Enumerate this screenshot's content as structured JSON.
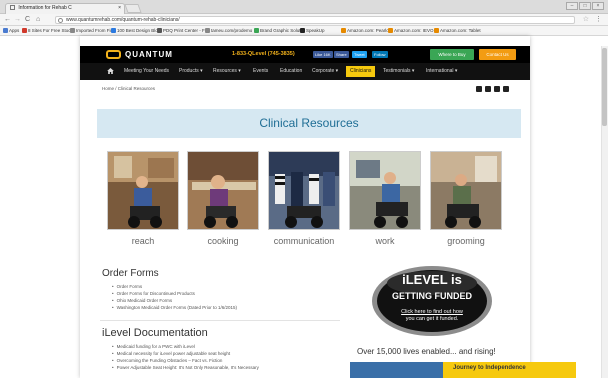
{
  "browser": {
    "tab_title": "Information for Rehab C",
    "tab_close": "×",
    "url": "www.quantumrehab.com/quantum-rehab-clinicians/",
    "win_controls": [
      "–",
      "□",
      "×"
    ],
    "nav": {
      "back": "←",
      "forward": "→",
      "reload": "C",
      "home": "⌂"
    },
    "star": "☆",
    "menu": "⋮"
  },
  "bookmarks": [
    {
      "label": "Apps",
      "color": "#4a7bd0"
    },
    {
      "label": "8 Sites For Free Stoc",
      "color": "#d0392b"
    },
    {
      "label": "Imported From Firef",
      "color": "#888888"
    },
    {
      "label": "100 Best Design Blo",
      "color": "#2d7be0"
    },
    {
      "label": "PDQ Print Center - F",
      "color": "#555555"
    },
    {
      "label": "tameu.com/prodemo",
      "color": "#888888"
    },
    {
      "label": "Brand Graphic Soluti",
      "color": "#3aa655"
    },
    {
      "label": "SpeakUp",
      "color": "#222222"
    },
    {
      "label": "Amazon.com: Pearlc",
      "color": "#e68a00"
    },
    {
      "label": "Amazon.com: IEVO",
      "color": "#e68a00"
    },
    {
      "label": "Amazon.com: Tablet",
      "color": "#e68a00"
    }
  ],
  "header": {
    "logo": "QUANTUM",
    "phone": "1-833-QLevel (745-3835)",
    "social": [
      {
        "label": "Like 16K",
        "color": "#3b5998"
      },
      {
        "label": "Share",
        "color": "#3b5998"
      },
      {
        "label": "Tweet",
        "color": "#1da1f2"
      },
      {
        "label": "Follow",
        "color": "#0077b5"
      }
    ],
    "cta": [
      {
        "label": "Where to Buy",
        "color": "#3aa655"
      },
      {
        "label": "Contact Us",
        "color": "#f39c12"
      }
    ]
  },
  "nav": {
    "items": [
      {
        "label": "Meeting Your Needs",
        "active": false
      },
      {
        "label": "Products ▾",
        "active": false
      },
      {
        "label": "Resources ▾",
        "active": false
      },
      {
        "label": "Events",
        "active": false
      },
      {
        "label": "Education",
        "active": false
      },
      {
        "label": "Corporate ▾",
        "active": false
      },
      {
        "label": "Clinicians",
        "active": true
      },
      {
        "label": "Testimonials ▾",
        "active": false
      },
      {
        "label": "International ▾",
        "active": false
      }
    ]
  },
  "breadcrumb": "Home / Clinical Resources",
  "banner_title": "Clinical Resources",
  "activities": [
    {
      "label": "reach"
    },
    {
      "label": "cooking"
    },
    {
      "label": "communication"
    },
    {
      "label": "work"
    },
    {
      "label": "grooming"
    }
  ],
  "order_forms": {
    "title": "Order Forms",
    "items": [
      "Order Forms",
      "Order Forms for Discontinued Products",
      "Ohio Medicaid Order Forms",
      "Washington Medicaid Order Forms (Dated Prior to 1/6/2015)"
    ]
  },
  "ilevel_docs": {
    "title": "iLevel Documentation",
    "items": [
      "Medicaid funding for a PWC with iLevel",
      "Medical necessity for iLevel power adjustable seat height",
      "Overcoming the Funding Obstacles – Fact vs. Fiction",
      "Power Adjustable Seat Height: It's Not Only Reasonable, It's Necessary"
    ]
  },
  "promo": {
    "line1": "iLEVEL is",
    "line2": "GETTING FUNDED",
    "line3": "Click here to find out how",
    "line4": "you can get it funded."
  },
  "tagline": "Over 15,000 lives enabled... and rising!",
  "journey": "Journey to Independence"
}
